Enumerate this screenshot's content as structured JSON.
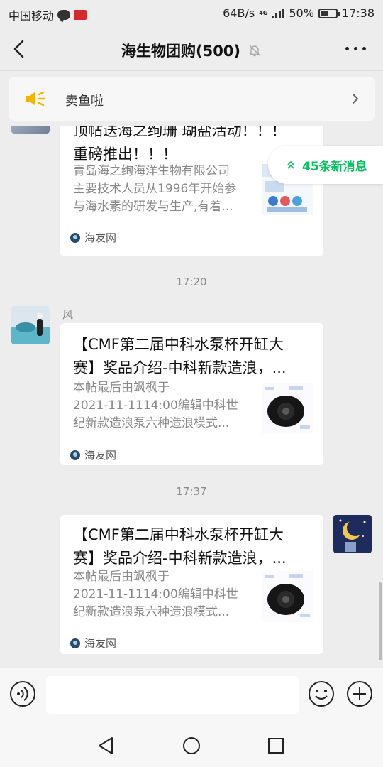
{
  "status_bar": {
    "carrier": "中国移动",
    "speed": "64B/s",
    "battery": "50%",
    "battery_level": 0.5,
    "time": "17:38",
    "network": "4G"
  },
  "header": {
    "title": "海生物团购(500)"
  },
  "notice": {
    "text": "卖鱼啦"
  },
  "new_messages": "45条新消息",
  "messages": [
    {
      "title": "顶帖送海之绚珊 瑚盐活动！！！\n重磅推出！！！",
      "desc": "青岛海之绚海洋生物有限公司\n主要技术人员从1996年开始参\n与海水素的研发与生产,有着...",
      "source": "海友网"
    },
    {
      "timestamp": "17:20",
      "sender": "风",
      "title": "【CMF第二届中科水泵杯开缸大\n赛】奖品介绍-中科新款造浪，...",
      "desc": "本帖最后由飒枫于\n2021-11-1114:00编辑中科世\n纪新款造浪泵六种造浪模式...",
      "source": "海友网"
    },
    {
      "timestamp": "17:37",
      "title": "【CMF第二届中科水泵杯开缸大\n赛】奖品介绍-中科新款造浪，...",
      "desc": "本帖最后由飒枫于\n2021-11-1114:00编辑中科世\n纪新款造浪泵六种造浪模式...",
      "source": "海友网"
    }
  ],
  "input": {
    "value": ""
  },
  "colors": {
    "accent_green": "#07c160",
    "background": "#ededed",
    "speaker_yellow": "#f5b400"
  }
}
